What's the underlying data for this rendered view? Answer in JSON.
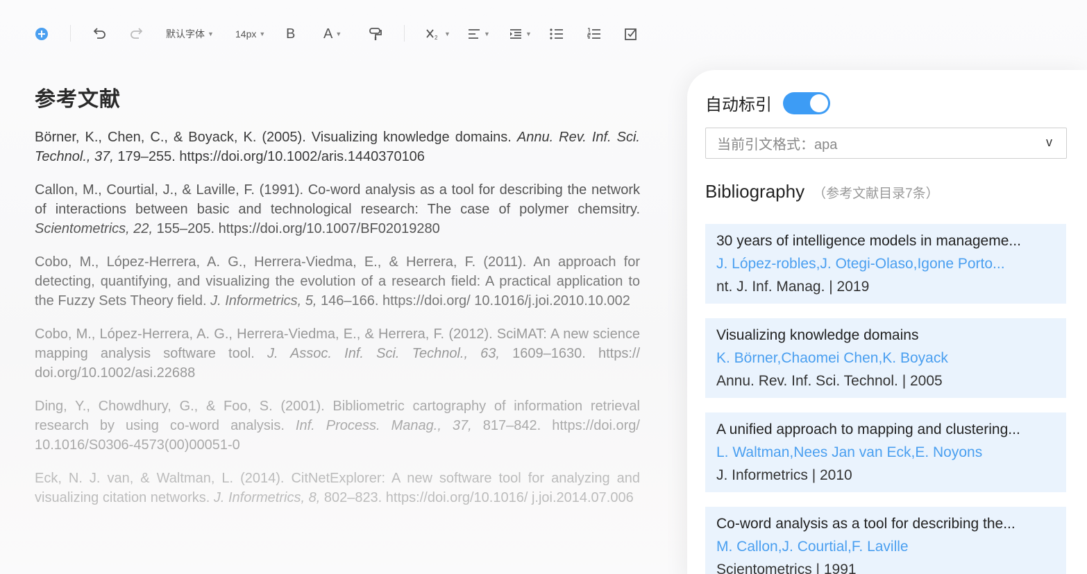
{
  "toolbar": {
    "font_family": "默认字体",
    "font_size": "14px",
    "bold_label": "B",
    "color_label": "A"
  },
  "document": {
    "heading": "参考文献",
    "references": [
      {
        "plain": "Börner, K., Chen, C., & Boyack, K. (2005). Visualizing knowledge domains. ",
        "italic": "Annu. Rev. Inf. Sci. Technol., 37,",
        "tail": " 179–255. https://doi.org/10.1002/aris.1440370106"
      },
      {
        "plain": "Callon, M., Courtial, J., & Laville, F. (1991). Co-word analysis as a tool for describing the network of interactions between basic and technological research: The case of polymer chemsitry. ",
        "italic": "Scientometrics, 22,",
        "tail": " 155–205. https://doi.org/10.1007/BF02019280"
      },
      {
        "plain": "Cobo, M., López-Herrera, A. G., Herrera-Viedma, E., & Herrera, F. (2011). An approach for detecting, quantifying, and visualizing the evolution of a research field: A practical application to the Fuzzy Sets Theory field. ",
        "italic": "J. Informetrics, 5,",
        "tail": " 146–166. https://doi.org/ 10.1016/j.joi.2010.10.002"
      },
      {
        "plain": "Cobo, M., López-Herrera, A. G., Herrera-Viedma, E., & Herrera, F. (2012). SciMAT: A new science mapping analysis software tool. ",
        "italic": "J. Assoc. Inf. Sci. Technol., 63,",
        "tail": " 1609–1630. https:// doi.org/10.1002/asi.22688"
      },
      {
        "plain": "Ding, Y., Chowdhury, G., & Foo, S. (2001). Bibliometric cartography of information retrieval research by using co-word analysis. ",
        "italic": "Inf. Process. Manag., 37,",
        "tail": " 817–842. https://doi.org/ 10.1016/S0306-4573(00)00051-0"
      },
      {
        "plain": "Eck, N. J. van, & Waltman, L. (2014). CitNetExplorer: A new software tool for analyzing and visualizing citation networks. ",
        "italic": "J. Informetrics, 8,",
        "tail": " 802–823. https://doi.org/10.1016/ j.joi.2014.07.006"
      }
    ]
  },
  "panel": {
    "auto_cite_label": "自动标引",
    "auto_cite_on": true,
    "format_select": "当前引文格式：apa",
    "format_chevron": "v",
    "bib_title": "Bibliography",
    "bib_count": "（参考文献目录7条）",
    "cards": [
      {
        "title": "30 years of intelligence models in manageme...",
        "authors": "J. López-robles,J. Otegi-Olaso,Igone Porto...",
        "journal": "nt. J. Inf. Manag. | 2019"
      },
      {
        "title": "Visualizing knowledge domains",
        "authors": "K. Börner,Chaomei Chen,K. Boyack",
        "journal": "Annu. Rev. Inf. Sci. Technol. | 2005"
      },
      {
        "title": "A unified approach to mapping and clustering...",
        "authors": "L. Waltman,Nees Jan van Eck,E. Noyons",
        "journal": "J. Informetrics | 2010"
      },
      {
        "title": "Co-word analysis as a tool for describing the...",
        "authors": "M. Callon,J. Courtial,F. Laville",
        "journal": "Scientometrics | 1991"
      }
    ]
  },
  "colors": {
    "accent": "#3d9cf5",
    "card_bg": "#eaf3fd",
    "author_link": "#4a9ff0"
  }
}
